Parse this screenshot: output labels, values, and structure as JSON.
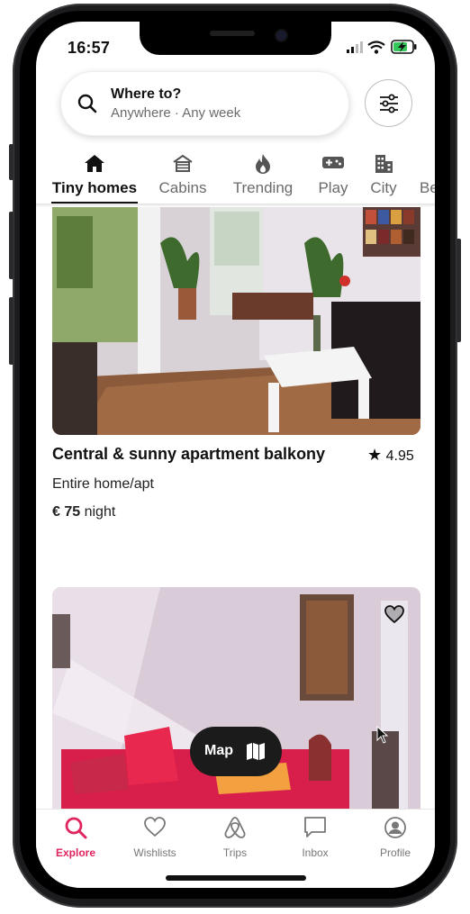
{
  "status_bar": {
    "time": "16:57"
  },
  "search": {
    "title": "Where to?",
    "subtitle": "Anywhere · Any week"
  },
  "categories": [
    {
      "label": "Tiny homes",
      "icon": "home-icon",
      "active": true
    },
    {
      "label": "Cabins",
      "icon": "cabin-icon"
    },
    {
      "label": "Trending",
      "icon": "fire-icon"
    },
    {
      "label": "Play",
      "icon": "gamepad-icon"
    },
    {
      "label": "City",
      "icon": "buildings-icon"
    },
    {
      "label": "Be",
      "icon": ""
    }
  ],
  "listings": [
    {
      "title": "Central & sunny apartment balkony",
      "rating": "4.95",
      "type": "Entire home/apt",
      "price": "€ 75",
      "price_unit": "night"
    }
  ],
  "map_button": {
    "label": "Map"
  },
  "bottom_nav": [
    {
      "label": "Explore",
      "icon": "search-icon",
      "active": true
    },
    {
      "label": "Wishlists",
      "icon": "heart-icon"
    },
    {
      "label": "Trips",
      "icon": "airbnb-logo-icon"
    },
    {
      "label": "Inbox",
      "icon": "message-icon"
    },
    {
      "label": "Profile",
      "icon": "profile-icon"
    }
  ],
  "colors": {
    "accent": "#e0245e",
    "text": "#111111",
    "muted": "#6a6a6a"
  }
}
